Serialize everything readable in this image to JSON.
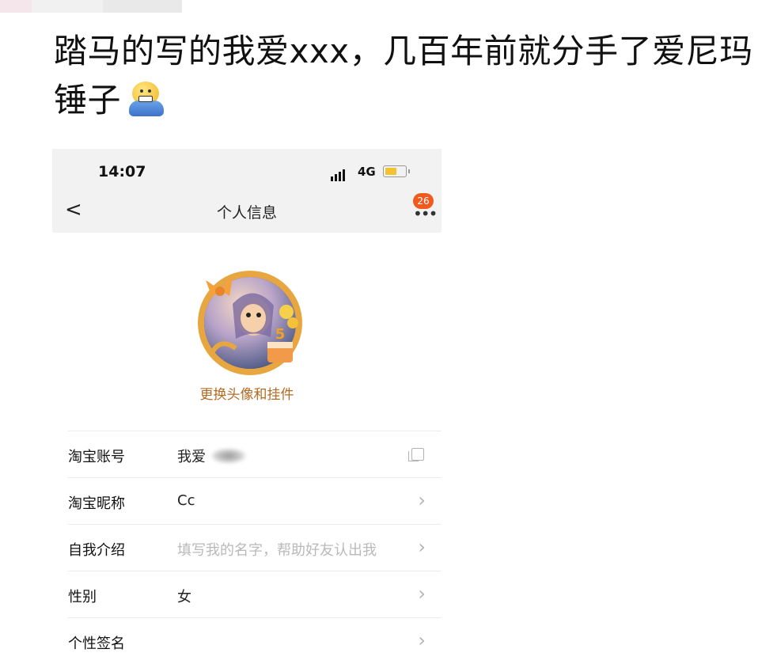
{
  "post": {
    "text": "踏马的写的我爱xxx，几百年前就分手了爱尼玛锤子",
    "emoji": "grimacing-face-emoji"
  },
  "status_bar": {
    "time": "14:07",
    "network": "4G"
  },
  "nav": {
    "back_icon": "<",
    "title": "个人信息",
    "badge_count": "26",
    "more_icon": "•••"
  },
  "profile": {
    "avatar_icon": "cartoon-avatar-with-ribbon-frame",
    "change_avatar_label": "更换头像和挂件"
  },
  "rows": [
    {
      "label": "淘宝账号",
      "value": "我爱",
      "value_suffix_blurred": true,
      "action_icon": "copy-icon"
    },
    {
      "label": "淘宝昵称",
      "value": "Cc",
      "action_icon": "chevron-right-icon"
    },
    {
      "label": "自我介绍",
      "placeholder": "填写我的名字，帮助好友认出我",
      "action_icon": "chevron-right-icon"
    },
    {
      "label": "性别",
      "value": "女",
      "action_icon": "chevron-right-icon"
    },
    {
      "label": "个性签名",
      "value": "",
      "action_icon": "chevron-right-icon"
    }
  ],
  "colors": {
    "accent": "#b56a22",
    "badge": "#f05a1f",
    "navbar_bg": "#f2f2f2"
  }
}
